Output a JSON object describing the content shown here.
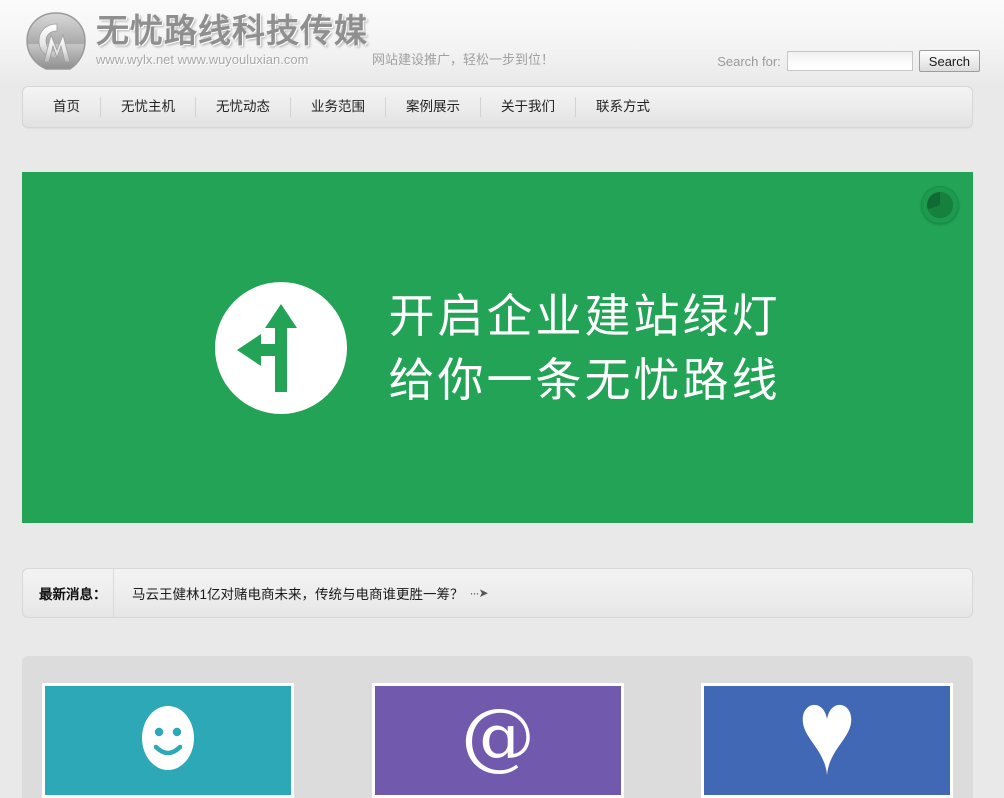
{
  "header": {
    "brand_title": "无忧路线科技传媒",
    "brand_urls": "www.wylx.net   www.wuyouluxian.com",
    "logo_icon": "shield-monogram-logo-icon",
    "tagline": "网站建设推广，轻松一步到位！",
    "search": {
      "label": "Search for:",
      "value": "",
      "placeholder": "",
      "button_label": "Search",
      "icon": "search-icon"
    }
  },
  "nav": {
    "items": [
      {
        "label": "首页"
      },
      {
        "label": "无忧主机"
      },
      {
        "label": "无忧动态"
      },
      {
        "label": "业务范围"
      },
      {
        "label": "案例展示"
      },
      {
        "label": "关于我们"
      },
      {
        "label": "联系方式"
      }
    ]
  },
  "banner": {
    "background_color": "#22a355",
    "icon": "turn-left-or-straight-arrow-icon",
    "line1": "开启企业建站绿灯",
    "line2": "给你一条无忧路线",
    "spinner": {
      "icon": "pie-progress-spinner-icon",
      "color": "#1d9a4e",
      "progress_percent": 75
    }
  },
  "news": {
    "label": "最新消息：",
    "headline": "马云王健林1亿对赌电商未来，传统与电商谁更胜一筹？",
    "arrow": "···➤"
  },
  "cards": {
    "panel_color": "#dcdcdc",
    "items": [
      {
        "name": "smiley-card",
        "icon": "smiley-face-icon",
        "color": "#2ca8b7"
      },
      {
        "name": "email-card",
        "icon": "at-sign-icon",
        "color": "#7159ae"
      },
      {
        "name": "heart-card",
        "icon": "heart-icon",
        "color": "#4168b4"
      }
    ]
  }
}
